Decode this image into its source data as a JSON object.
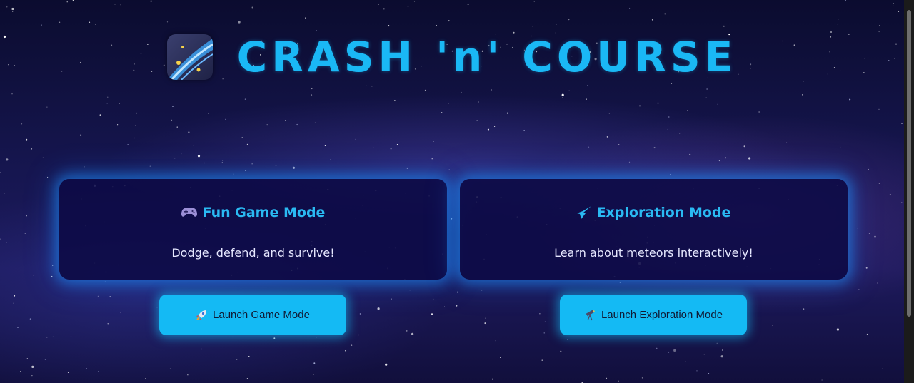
{
  "header": {
    "logo_icon": "comet-stars-icon",
    "title": "CRASH 'n' COURSE"
  },
  "cards": [
    {
      "icon": "game-controller-icon",
      "title": "Fun Game Mode",
      "description": "Dodge, defend, and survive!"
    },
    {
      "icon": "comet-icon",
      "title": "Exploration Mode",
      "description": "Learn about meteors interactively!"
    }
  ],
  "buttons": [
    {
      "icon": "rocket-icon",
      "label": "Launch Game Mode"
    },
    {
      "icon": "telescope-icon",
      "label": "Launch Exploration Mode"
    }
  ],
  "colors": {
    "accent": "#1ab8f5",
    "button": "#14baf4",
    "card_bg": "#0c0a46",
    "glow": "#1e96ff"
  }
}
